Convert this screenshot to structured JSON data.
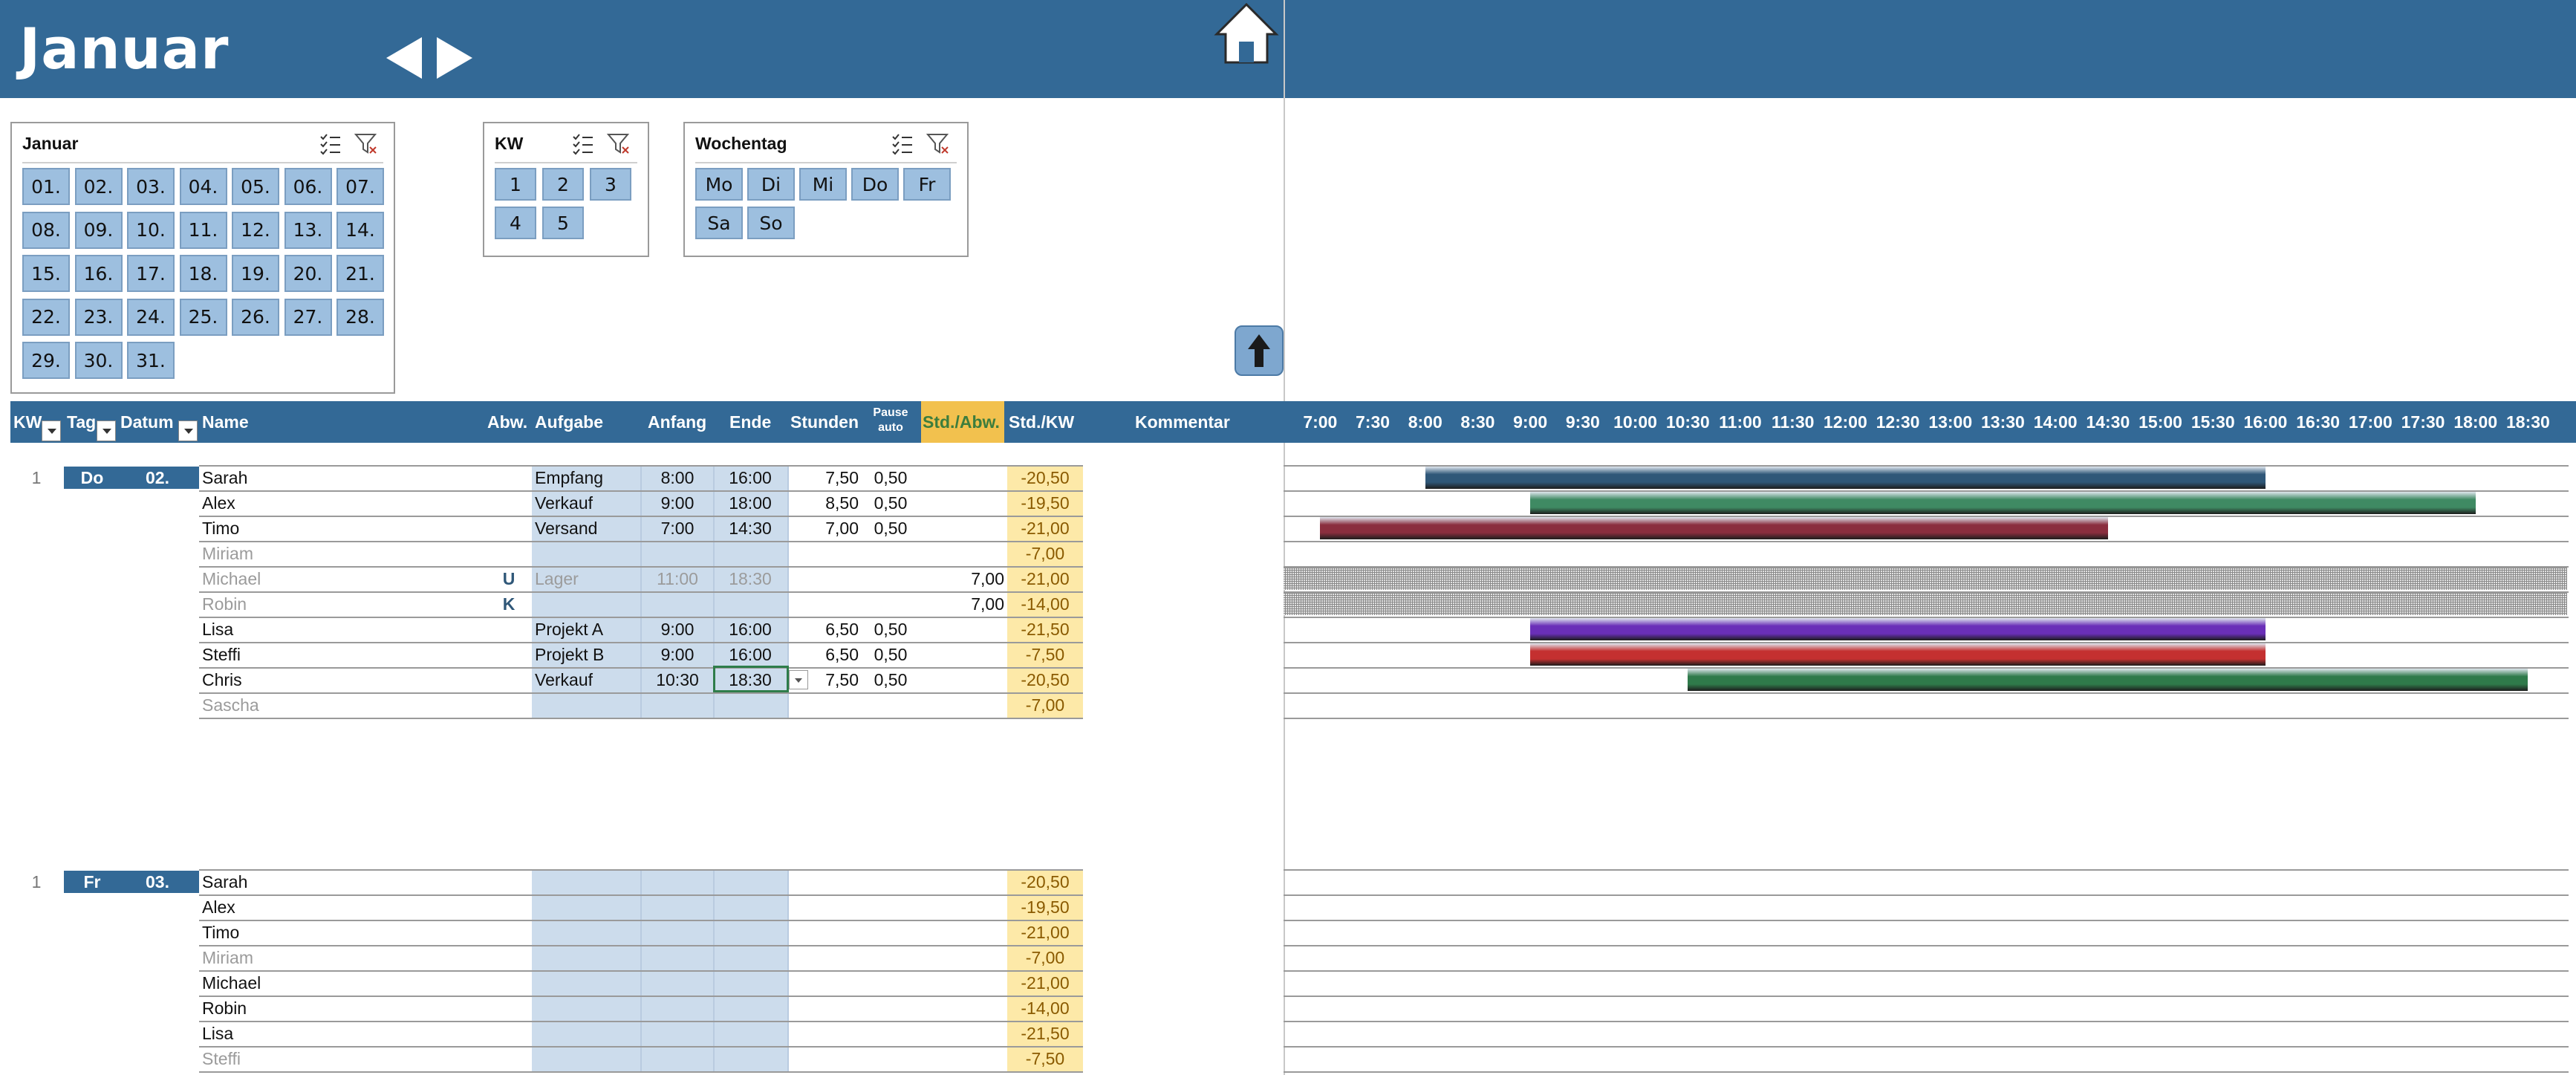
{
  "header": {
    "title": "Januar"
  },
  "slicers": {
    "month": {
      "title": "Januar",
      "days": [
        "01.",
        "02.",
        "03.",
        "04.",
        "05.",
        "06.",
        "07.",
        "08.",
        "09.",
        "10.",
        "11.",
        "12.",
        "13.",
        "14.",
        "15.",
        "16.",
        "17.",
        "18.",
        "19.",
        "20.",
        "21.",
        "22.",
        "23.",
        "24.",
        "25.",
        "26.",
        "27.",
        "28.",
        "29.",
        "30.",
        "31."
      ]
    },
    "kw": {
      "title": "KW",
      "items": [
        "1",
        "2",
        "3",
        "4",
        "5"
      ]
    },
    "weekday": {
      "title": "Wochentag",
      "items": [
        "Mo",
        "Di",
        "Mi",
        "Do",
        "Fr",
        "Sa",
        "So"
      ]
    }
  },
  "columns": {
    "kw": "KW",
    "tag": "Tag",
    "datum": "Datum",
    "name": "Name",
    "abw": "Abw.",
    "aufgabe": "Aufgabe",
    "anfang": "Anfang",
    "ende": "Ende",
    "stunden": "Stunden",
    "pause_line1": "Pause",
    "pause_line2": "auto",
    "std_abw": "Std./Abw.",
    "std_kw": "Std./KW",
    "kommentar": "Kommentar"
  },
  "timeline": [
    "7:00",
    "7:30",
    "8:00",
    "8:30",
    "9:00",
    "9:30",
    "10:00",
    "10:30",
    "11:00",
    "11:30",
    "12:00",
    "12:30",
    "13:00",
    "13:30",
    "14:00",
    "14:30",
    "15:00",
    "15:30",
    "16:00",
    "16:30",
    "17:00",
    "17:30",
    "18:00",
    "18:30"
  ],
  "colors": {
    "header": "#336996",
    "slicer_tile": "#9dbfdf",
    "std_abw_header": "#f2c14e",
    "input_cell": "#ccdcec",
    "std_kw_cell": "#fde9a8"
  },
  "days": [
    {
      "kw": "1",
      "tag": "Do",
      "datum": "02.",
      "rows": [
        {
          "name": "Sarah",
          "abw": "",
          "aufgabe": "Empfang",
          "anfang": "8:00",
          "ende": "16:00",
          "stunden": "7,50",
          "pause": "0,50",
          "std_abw": "",
          "std_kw": "-20,50",
          "gray": false
        },
        {
          "name": "Alex",
          "abw": "",
          "aufgabe": "Verkauf",
          "anfang": "9:00",
          "ende": "18:00",
          "stunden": "8,50",
          "pause": "0,50",
          "std_abw": "",
          "std_kw": "-19,50",
          "gray": false
        },
        {
          "name": "Timo",
          "abw": "",
          "aufgabe": "Versand",
          "anfang": "7:00",
          "ende": "14:30",
          "stunden": "7,00",
          "pause": "0,50",
          "std_abw": "",
          "std_kw": "-21,00",
          "gray": false
        },
        {
          "name": "Miriam",
          "abw": "",
          "aufgabe": "",
          "anfang": "",
          "ende": "",
          "stunden": "",
          "pause": "",
          "std_abw": "",
          "std_kw": "-7,00",
          "gray": true
        },
        {
          "name": "Michael",
          "abw": "U",
          "aufgabe": "Lager",
          "anfang": "11:00",
          "ende": "18:30",
          "stunden": "",
          "pause": "",
          "std_abw": "7,00",
          "std_kw": "-21,00",
          "gray": true
        },
        {
          "name": "Robin",
          "abw": "K",
          "aufgabe": "",
          "anfang": "",
          "ende": "",
          "stunden": "",
          "pause": "",
          "std_abw": "7,00",
          "std_kw": "-14,00",
          "gray": true
        },
        {
          "name": "Lisa",
          "abw": "",
          "aufgabe": "Projekt A",
          "anfang": "9:00",
          "ende": "16:00",
          "stunden": "6,50",
          "pause": "0,50",
          "std_abw": "",
          "std_kw": "-21,50",
          "gray": false
        },
        {
          "name": "Steffi",
          "abw": "",
          "aufgabe": "Projekt B",
          "anfang": "9:00",
          "ende": "16:00",
          "stunden": "6,50",
          "pause": "0,50",
          "std_abw": "",
          "std_kw": "-7,50",
          "gray": false
        },
        {
          "name": "Chris",
          "abw": "",
          "aufgabe": "Verkauf",
          "anfang": "10:30",
          "ende": "18:30",
          "stunden": "7,50",
          "pause": "0,50",
          "std_abw": "",
          "std_kw": "-20,50",
          "gray": false
        },
        {
          "name": "Sascha",
          "abw": "",
          "aufgabe": "",
          "anfang": "",
          "ende": "",
          "stunden": "",
          "pause": "",
          "std_abw": "",
          "std_kw": "-7,00",
          "gray": true
        }
      ]
    },
    {
      "kw": "1",
      "tag": "Fr",
      "datum": "03.",
      "rows": [
        {
          "name": "Sarah",
          "abw": "",
          "aufgabe": "",
          "anfang": "",
          "ende": "",
          "stunden": "",
          "pause": "",
          "std_abw": "",
          "std_kw": "-20,50",
          "gray": false
        },
        {
          "name": "Alex",
          "abw": "",
          "aufgabe": "",
          "anfang": "",
          "ende": "",
          "stunden": "",
          "pause": "",
          "std_abw": "",
          "std_kw": "-19,50",
          "gray": false
        },
        {
          "name": "Timo",
          "abw": "",
          "aufgabe": "",
          "anfang": "",
          "ende": "",
          "stunden": "",
          "pause": "",
          "std_abw": "",
          "std_kw": "-21,00",
          "gray": false
        },
        {
          "name": "Miriam",
          "abw": "",
          "aufgabe": "",
          "anfang": "",
          "ende": "",
          "stunden": "",
          "pause": "",
          "std_abw": "",
          "std_kw": "-7,00",
          "gray": true
        },
        {
          "name": "Michael",
          "abw": "",
          "aufgabe": "",
          "anfang": "",
          "ende": "",
          "stunden": "",
          "pause": "",
          "std_abw": "",
          "std_kw": "-21,00",
          "gray": false
        },
        {
          "name": "Robin",
          "abw": "",
          "aufgabe": "",
          "anfang": "",
          "ende": "",
          "stunden": "",
          "pause": "",
          "std_abw": "",
          "std_kw": "-14,00",
          "gray": false
        },
        {
          "name": "Lisa",
          "abw": "",
          "aufgabe": "",
          "anfang": "",
          "ende": "",
          "stunden": "",
          "pause": "",
          "std_abw": "",
          "std_kw": "-21,50",
          "gray": false
        },
        {
          "name": "Steffi",
          "abw": "",
          "aufgabe": "",
          "anfang": "",
          "ende": "",
          "stunden": "",
          "pause": "",
          "std_abw": "",
          "std_kw": "-7,50",
          "gray": true
        }
      ]
    }
  ]
}
